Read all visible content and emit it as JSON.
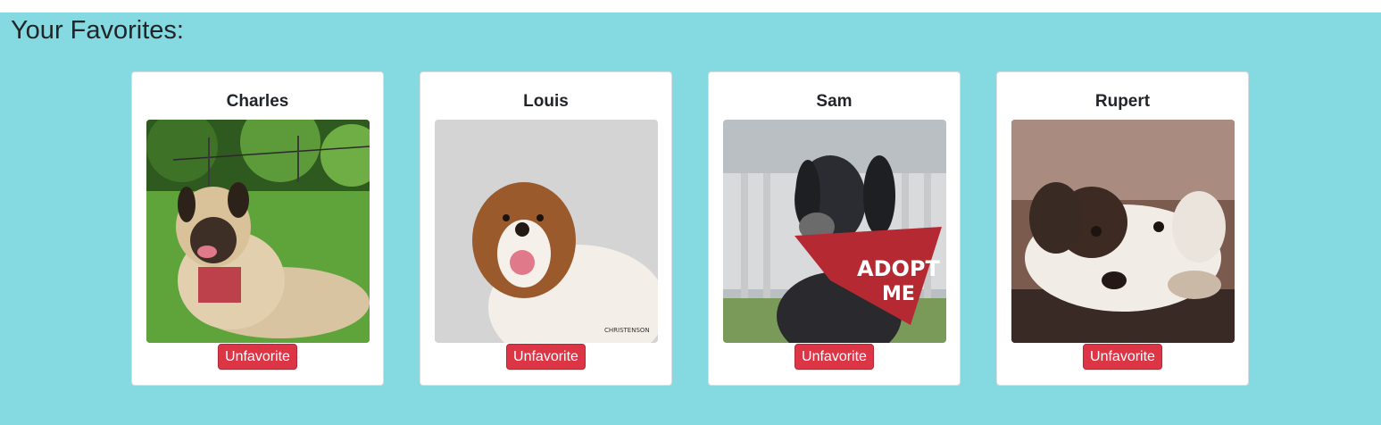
{
  "page": {
    "heading": "Your Favorites:"
  },
  "favorites": [
    {
      "name": "Charles",
      "button_label": "Unfavorite"
    },
    {
      "name": "Louis",
      "button_label": "Unfavorite",
      "photo_watermark": "CHRISTENSON"
    },
    {
      "name": "Sam",
      "button_label": "Unfavorite",
      "bandana_text": [
        "ADOPT",
        "ME"
      ]
    },
    {
      "name": "Rupert",
      "button_label": "Unfavorite"
    }
  ],
  "colors": {
    "page_background": "#84dae0",
    "card_background": "#ffffff",
    "button_background": "#dc3545",
    "button_text": "#ffffff"
  }
}
